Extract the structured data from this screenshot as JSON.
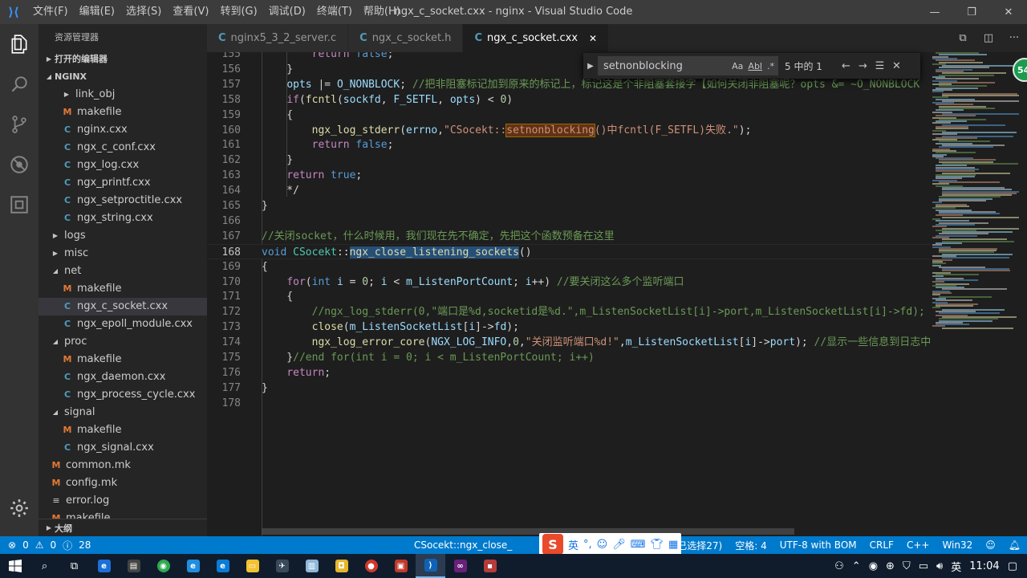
{
  "titlebar": {
    "menus": [
      "文件(F)",
      "编辑(E)",
      "选择(S)",
      "查看(V)",
      "转到(G)",
      "调试(D)",
      "终端(T)",
      "帮助(H)"
    ],
    "window_title": "ngx_c_socket.cxx - nginx - Visual Studio Code",
    "minimize": "—",
    "maximize": "❐",
    "close": "✕"
  },
  "sidebar": {
    "title": "资源管理器",
    "open_editors": "打开的编辑器",
    "root": "NGINX",
    "tree": [
      {
        "label": "link_obj",
        "type": "folder",
        "level": 2,
        "open": false
      },
      {
        "label": "makefile",
        "type": "m",
        "level": 2
      },
      {
        "label": "nginx.cxx",
        "type": "c",
        "level": 2
      },
      {
        "label": "ngx_c_conf.cxx",
        "type": "c",
        "level": 2
      },
      {
        "label": "ngx_log.cxx",
        "type": "c",
        "level": 2
      },
      {
        "label": "ngx_printf.cxx",
        "type": "c",
        "level": 2
      },
      {
        "label": "ngx_setproctitle.cxx",
        "type": "c",
        "level": 2
      },
      {
        "label": "ngx_string.cxx",
        "type": "c",
        "level": 2
      },
      {
        "label": "logs",
        "type": "folder",
        "level": 1,
        "open": false
      },
      {
        "label": "misc",
        "type": "folder",
        "level": 1,
        "open": false
      },
      {
        "label": "net",
        "type": "folder",
        "level": 1,
        "open": true
      },
      {
        "label": "makefile",
        "type": "m",
        "level": 2
      },
      {
        "label": "ngx_c_socket.cxx",
        "type": "c",
        "level": 2,
        "selected": true
      },
      {
        "label": "ngx_epoll_module.cxx",
        "type": "c",
        "level": 2
      },
      {
        "label": "proc",
        "type": "folder",
        "level": 1,
        "open": true
      },
      {
        "label": "makefile",
        "type": "m",
        "level": 2
      },
      {
        "label": "ngx_daemon.cxx",
        "type": "c",
        "level": 2
      },
      {
        "label": "ngx_process_cycle.cxx",
        "type": "c",
        "level": 2
      },
      {
        "label": "signal",
        "type": "folder",
        "level": 1,
        "open": true
      },
      {
        "label": "makefile",
        "type": "m",
        "level": 2
      },
      {
        "label": "ngx_signal.cxx",
        "type": "c",
        "level": 2
      },
      {
        "label": "common.mk",
        "type": "m",
        "level": 1
      },
      {
        "label": "config.mk",
        "type": "m",
        "level": 1
      },
      {
        "label": "error.log",
        "type": "e",
        "level": 1
      },
      {
        "label": "makefile",
        "type": "m",
        "level": 1
      }
    ],
    "outline": "大纲"
  },
  "tabs": [
    {
      "label": "nginx5_3_2_server.c",
      "active": false
    },
    {
      "label": "ngx_c_socket.h",
      "active": false
    },
    {
      "label": "ngx_c_socket.cxx",
      "active": true
    }
  ],
  "find": {
    "query": "setnonblocking",
    "case_label": "Aa",
    "word_label": "Abl",
    "regex_label": ".*",
    "count": "5 中的 1"
  },
  "code_lines": [
    {
      "n": "155",
      "html": "        <span class=\"ctl\">return</span> <span class=\"k\">false</span>;"
    },
    {
      "n": "156",
      "html": "    }"
    },
    {
      "n": "157",
      "html": "    <span class=\"vr\">opts</span> |= <span class=\"vr\">O_NONBLOCK</span>; <span class=\"cm\">//把非阻塞标记加到原来的标记上，标记这是个非阻塞套接字【如何关闭非阻塞呢？opts &amp;= ~O_NONBLOCK</span>"
    },
    {
      "n": "158",
      "html": "    <span class=\"ctl\">if</span>(<span class=\"fn\">fcntl</span>(<span class=\"vr\">sockfd</span>, <span class=\"vr\">F_SETFL</span>, <span class=\"vr\">opts</span>) &lt; <span class=\"num\">0</span>)"
    },
    {
      "n": "159",
      "html": "    {"
    },
    {
      "n": "160",
      "html": "        <span class=\"fn\">ngx_log_stderr</span>(<span class=\"vr\">errno</span>,<span class=\"str\">\"CSocekt::<span class=\"find\">setnonblocking</span>()中fcntl(F_SETFL)失败.\"</span>);"
    },
    {
      "n": "161",
      "html": "        <span class=\"ctl\">return</span> <span class=\"k\">false</span>;"
    },
    {
      "n": "162",
      "html": "    }"
    },
    {
      "n": "163",
      "html": "    <span class=\"ctl\">return</span> <span class=\"k\">true</span>;"
    },
    {
      "n": "164",
      "html": "    */"
    },
    {
      "n": "165",
      "html": "}"
    },
    {
      "n": "166",
      "html": ""
    },
    {
      "n": "167",
      "html": "<span class=\"cm\">//关闭socket，什么时候用，我们现在先不确定，先把这个函数预备在这里</span>"
    },
    {
      "n": "168",
      "html": "<span class=\"k\">void</span> <span class=\"ty\">CSocekt</span>::<span class=\"fn sel\">ngx_close_listening_sockets</span>()",
      "current": true
    },
    {
      "n": "169",
      "html": "{"
    },
    {
      "n": "170",
      "html": "    <span class=\"ctl\">for</span>(<span class=\"k\">int</span> <span class=\"vr\">i</span> = <span class=\"num\">0</span>; <span class=\"vr\">i</span> &lt; <span class=\"vr\">m_ListenPortCount</span>; <span class=\"vr\">i</span>++) <span class=\"cm\">//要关闭这么多个监听端口</span>"
    },
    {
      "n": "171",
      "html": "    {"
    },
    {
      "n": "172",
      "html": "        <span class=\"cm\">//ngx_log_stderr(0,\"端口是%d,socketid是%d.\",m_ListenSocketList[i]-&gt;port,m_ListenSocketList[i]-&gt;fd);</span>"
    },
    {
      "n": "173",
      "html": "        <span class=\"fn\">close</span>(<span class=\"vr\">m_ListenSocketList</span>[<span class=\"vr\">i</span>]-&gt;<span class=\"vr\">fd</span>);"
    },
    {
      "n": "174",
      "html": "        <span class=\"fn\">ngx_log_error_core</span>(<span class=\"vr\">NGX_LOG_INFO</span>,<span class=\"num\">0</span>,<span class=\"str\">\"关闭监听端口%d!\"</span>,<span class=\"vr\">m_ListenSocketList</span>[<span class=\"vr\">i</span>]-&gt;<span class=\"vr\">port</span>); <span class=\"cm\">//显示一些信息到日志中</span>"
    },
    {
      "n": "175",
      "html": "    }<span class=\"cm\">//end for(int i = 0; i &lt; m_ListenPortCount; i++)</span>"
    },
    {
      "n": "176",
      "html": "    <span class=\"ctl\">return</span>;"
    },
    {
      "n": "177",
      "html": "}"
    },
    {
      "n": "178",
      "html": ""
    }
  ],
  "avatar_badge": "54",
  "statusbar": {
    "errors": "0",
    "warnings": "0",
    "info": "28",
    "symbol": "CSocekt::ngx_close_",
    "selection": "已选择27)",
    "spaces": "空格: 4",
    "encoding": "UTF-8 with BOM",
    "eol": "CRLF",
    "language": "C++",
    "platform": "Win32"
  },
  "ime": {
    "logo": "S",
    "lang": "英"
  },
  "taskbar": {
    "time": "11:04"
  },
  "colors": {
    "accent": "#007acc",
    "titlebar": "#3c3c3c",
    "activitybar": "#333333",
    "sidebar": "#252526",
    "editor": "#1e1e1e"
  }
}
